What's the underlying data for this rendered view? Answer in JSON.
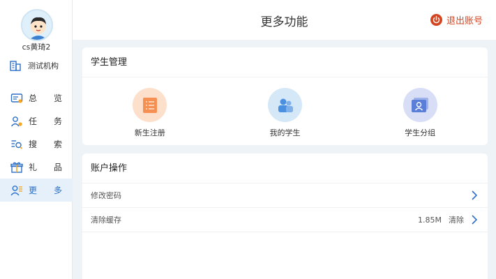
{
  "user": {
    "name": "cs黄琦2"
  },
  "org": {
    "label": "测试机构"
  },
  "nav": [
    {
      "label1": "总",
      "label2": "览",
      "icon": "overview-icon"
    },
    {
      "label1": "任",
      "label2": "务",
      "icon": "task-icon"
    },
    {
      "label1": "搜",
      "label2": "索",
      "icon": "search-icon"
    },
    {
      "label1": "礼",
      "label2": "品",
      "icon": "gift-icon"
    },
    {
      "label1": "更",
      "label2": "多",
      "icon": "more-icon"
    }
  ],
  "header": {
    "title": "更多功能",
    "logout": "退出账号"
  },
  "student_section": {
    "title": "学生管理",
    "tiles": [
      {
        "label": "新生注册",
        "icon": "register-icon",
        "color": "#f58f52"
      },
      {
        "label": "我的学生",
        "icon": "students-icon",
        "color": "#4a8fe0"
      },
      {
        "label": "学生分组",
        "icon": "group-icon",
        "color": "#5b7fd8"
      }
    ]
  },
  "account_section": {
    "title": "账户操作",
    "rows": [
      {
        "label": "修改密码"
      },
      {
        "label": "清除缓存",
        "value": "1.85M",
        "action": "清除"
      }
    ]
  },
  "colors": {
    "accent": "#2b6fc7",
    "logout": "#d34420",
    "background": "#eef3f8"
  }
}
